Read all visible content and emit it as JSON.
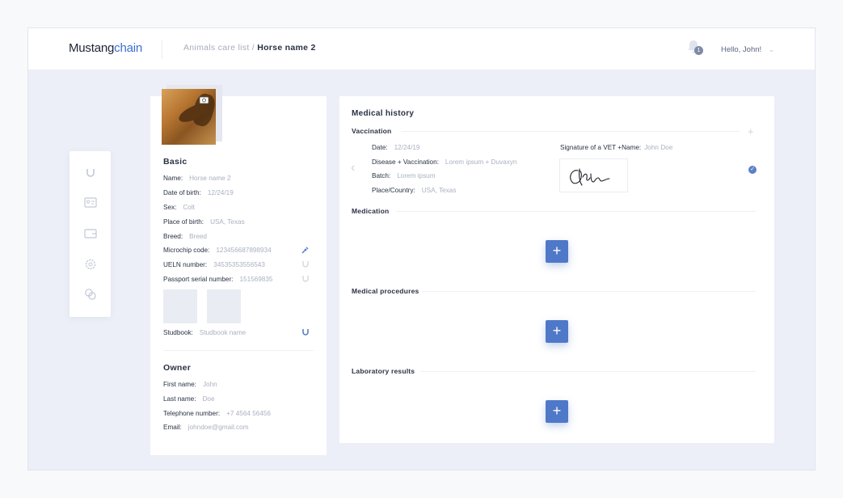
{
  "header": {
    "logo_bold": "Mustang",
    "logo_light": "chain",
    "breadcrumb_parent": "Animals care list",
    "breadcrumb_sep": " / ",
    "breadcrumb_current": "Horse name 2",
    "notification_count": "1",
    "greeting": "Hello, John!"
  },
  "sidenav": {
    "icons": [
      "horseshoe-icon",
      "id-card-icon",
      "wallet-icon",
      "settings-icon",
      "coins-icon"
    ]
  },
  "basic": {
    "title": "Basic",
    "fields": [
      {
        "label": "Name:",
        "value": "Horse name 2"
      },
      {
        "label": "Date of birth:",
        "value": "12/24/19"
      },
      {
        "label": "Sex:",
        "value": "Colt"
      },
      {
        "label": "Place of birth:",
        "value": "USA, Texas"
      },
      {
        "label": "Breed:",
        "value": "Breed"
      },
      {
        "label": "Microchip code:",
        "value": "123456687898934"
      },
      {
        "label": "UELN number:",
        "value": "34535353556543"
      },
      {
        "label": "Passport serial number:",
        "value": "151569835"
      }
    ],
    "studbook_label": "Studbook:",
    "studbook_value": "Studbook name"
  },
  "owner": {
    "title": "Owner",
    "fields": [
      {
        "label": "First name:",
        "value": "John"
      },
      {
        "label": "Last name:",
        "value": "Doe"
      },
      {
        "label": "Telephone number:",
        "value": "+7 4564 56456"
      },
      {
        "label": "Email:",
        "value": "johndoe@gmail.com"
      }
    ]
  },
  "medical": {
    "title": "Medical history",
    "vaccination": {
      "title": "Vaccination",
      "fields": [
        {
          "label": "Date:",
          "value": "12/24/19"
        },
        {
          "label": "Disease + Vaccination:",
          "value": "Lorem ipsum + Duvaxyn"
        },
        {
          "label": "Batch:",
          "value": "Lorem ipsum"
        },
        {
          "label": "Place/Country:",
          "value": "USA, Texas"
        }
      ],
      "signature_label": "Signature of a VET +Name:",
      "signature_name": "John Doe"
    },
    "medication_title": "Medication",
    "procedures_title": "Medical procedures",
    "lab_title": "Laboratory results",
    "add_label": "+"
  }
}
